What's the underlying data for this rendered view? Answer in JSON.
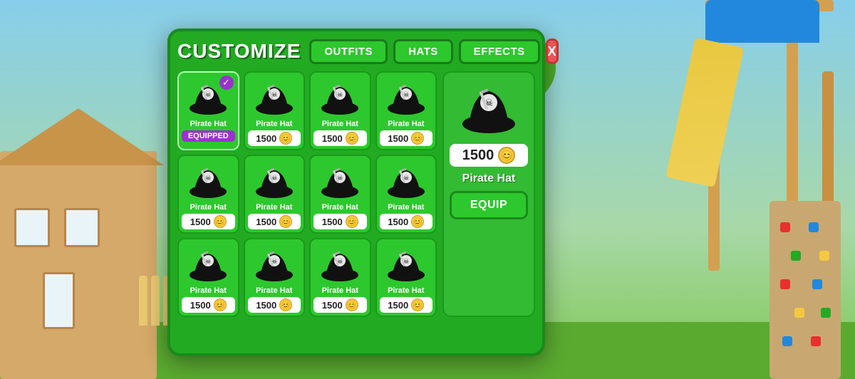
{
  "background": {
    "sky_color": "#87CEEB",
    "grass_color": "#5aaa30"
  },
  "panel": {
    "title": "CUSTOMIZE",
    "close_label": "X",
    "tabs": [
      {
        "id": "outfits",
        "label": "OUTFITS",
        "active": false
      },
      {
        "id": "hats",
        "label": "HATS",
        "active": true
      },
      {
        "id": "effects",
        "label": "EFFECTS",
        "active": false
      }
    ],
    "grid_items": [
      {
        "name": "Pirate Hat",
        "price": null,
        "status": "equipped",
        "has_check": true
      },
      {
        "name": "Pirate Hat",
        "price": "1500",
        "status": null
      },
      {
        "name": "Pirate Hat",
        "price": "1500",
        "status": null
      },
      {
        "name": "Pirate Hat",
        "price": "1500",
        "status": null
      },
      {
        "name": "Pirate Hat",
        "price": "1500",
        "status": null
      },
      {
        "name": "Pirate Hat",
        "price": "1500",
        "status": null
      },
      {
        "name": "Pirate Hat",
        "price": "1500",
        "status": null
      },
      {
        "name": "Pirate Hat",
        "price": "1500",
        "status": null
      },
      {
        "name": "Pirate Hat",
        "price": "1500",
        "status": null
      },
      {
        "name": "Pirate Hat",
        "price": "1500",
        "status": null
      },
      {
        "name": "Pirate Hat",
        "price": "1500",
        "status": null
      },
      {
        "name": "Pirate Hat",
        "price": "1500",
        "status": null
      }
    ],
    "side_panel": {
      "item_name": "Pirate Hat",
      "price": "1500",
      "equip_label": "EQUIP"
    },
    "equipped_label": "EQUIPPED",
    "currency_icon": "😊"
  }
}
